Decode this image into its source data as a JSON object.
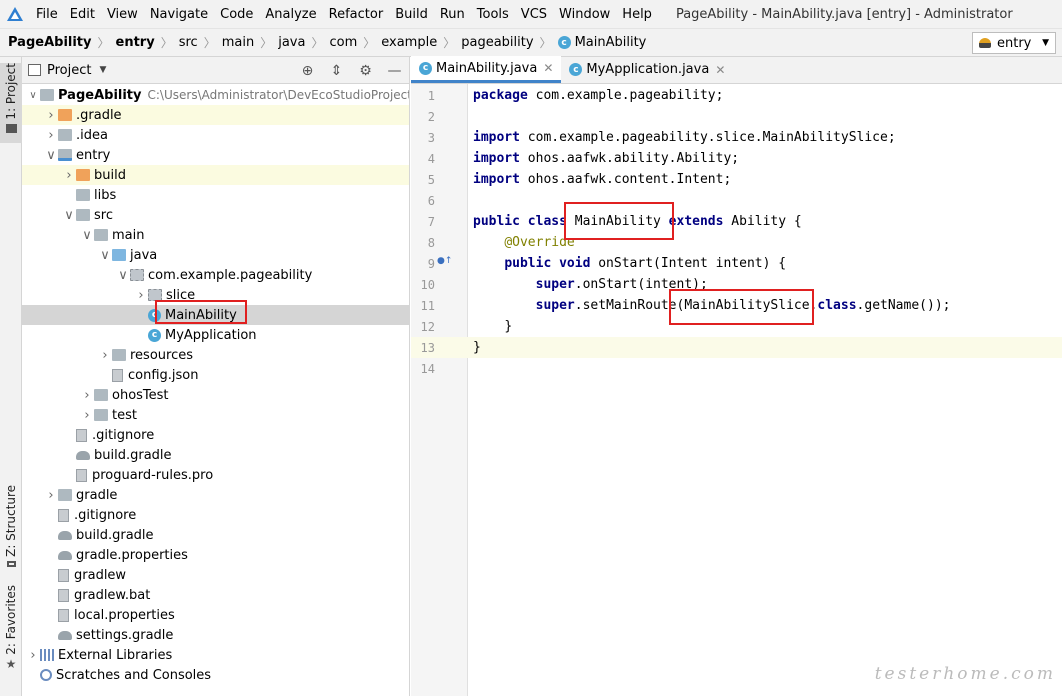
{
  "menubar": {
    "items": [
      "File",
      "Edit",
      "View",
      "Navigate",
      "Code",
      "Analyze",
      "Refactor",
      "Build",
      "Run",
      "Tools",
      "VCS",
      "Window",
      "Help"
    ],
    "window_title": "PageAbility - MainAbility.java [entry] - Administrator"
  },
  "breadcrumbs": [
    "PageAbility",
    "entry",
    "src",
    "main",
    "java",
    "com",
    "example",
    "pageability",
    "MainAbility"
  ],
  "run_config": "entry",
  "left_tabs": {
    "project": "1: Project",
    "structure": "Z: Structure",
    "favorites": "2: Favorites"
  },
  "project_panel": {
    "title": "Project",
    "root_name": "PageAbility",
    "root_path": "C:\\Users\\Administrator\\DevEcoStudioProjects\\",
    "tree": [
      {
        "label": ".gradle",
        "icon": "orange-folder"
      },
      {
        "label": ".idea",
        "icon": "folder"
      },
      {
        "label": "entry",
        "icon": "module-folder"
      },
      {
        "label": "build",
        "icon": "orange-folder"
      },
      {
        "label": "libs",
        "icon": "folder"
      },
      {
        "label": "src",
        "icon": "folder"
      },
      {
        "label": "main",
        "icon": "folder"
      },
      {
        "label": "java",
        "icon": "blue-folder"
      },
      {
        "label": "com.example.pageability",
        "icon": "package"
      },
      {
        "label": "slice",
        "icon": "package"
      },
      {
        "label": "MainAbility",
        "icon": "class"
      },
      {
        "label": "MyApplication",
        "icon": "class"
      },
      {
        "label": "resources",
        "icon": "folder"
      },
      {
        "label": "config.json",
        "icon": "json"
      },
      {
        "label": "ohosTest",
        "icon": "folder"
      },
      {
        "label": "test",
        "icon": "folder"
      },
      {
        "label": ".gitignore",
        "icon": "file"
      },
      {
        "label": "build.gradle",
        "icon": "gradle"
      },
      {
        "label": "proguard-rules.pro",
        "icon": "file"
      },
      {
        "label": "gradle",
        "icon": "folder"
      },
      {
        "label": ".gitignore",
        "icon": "file"
      },
      {
        "label": "build.gradle",
        "icon": "gradle"
      },
      {
        "label": "gradle.properties",
        "icon": "gradle"
      },
      {
        "label": "gradlew",
        "icon": "file"
      },
      {
        "label": "gradlew.bat",
        "icon": "file"
      },
      {
        "label": "local.properties",
        "icon": "file"
      },
      {
        "label": "settings.gradle",
        "icon": "gradle"
      },
      {
        "label": "External Libraries",
        "icon": "library"
      },
      {
        "label": "Scratches and Consoles",
        "icon": "scratch"
      }
    ]
  },
  "editor": {
    "tabs": [
      "MainAbility.java",
      "MyApplication.java"
    ],
    "line_numbers": [
      "1",
      "2",
      "3",
      "4",
      "5",
      "6",
      "7",
      "8",
      "9",
      "10",
      "11",
      "12",
      "13",
      "14"
    ],
    "code": {
      "l1_kw": "package",
      "l1": " com.example.pageability;",
      "l3_kw": "import",
      "l3": " com.example.pageability.slice.MainAbilitySlice;",
      "l4_kw": "import",
      "l4": " ohos.aafwk.ability.Ability;",
      "l5_kw": "import",
      "l5": " ohos.aafwk.content.Intent;",
      "l7_kw1": "public class",
      "l7_name": " MainAbility ",
      "l7_kw2": "extends",
      "l7_rest": " Ability {",
      "l8": "@Override",
      "l9_kw": "public void",
      "l9": " onStart(Intent intent) {",
      "l10_kw": "super",
      ".l10": "",
      "l10": ".onStart(intent);",
      "l11_kw": "super",
      "l11a": ".setMainRoute(MainAbilitySlice.",
      "l11_kw2": "class",
      "l11b": ".getName());",
      "l12": "}",
      "l13": "}"
    }
  },
  "watermark": "testerhome.com"
}
